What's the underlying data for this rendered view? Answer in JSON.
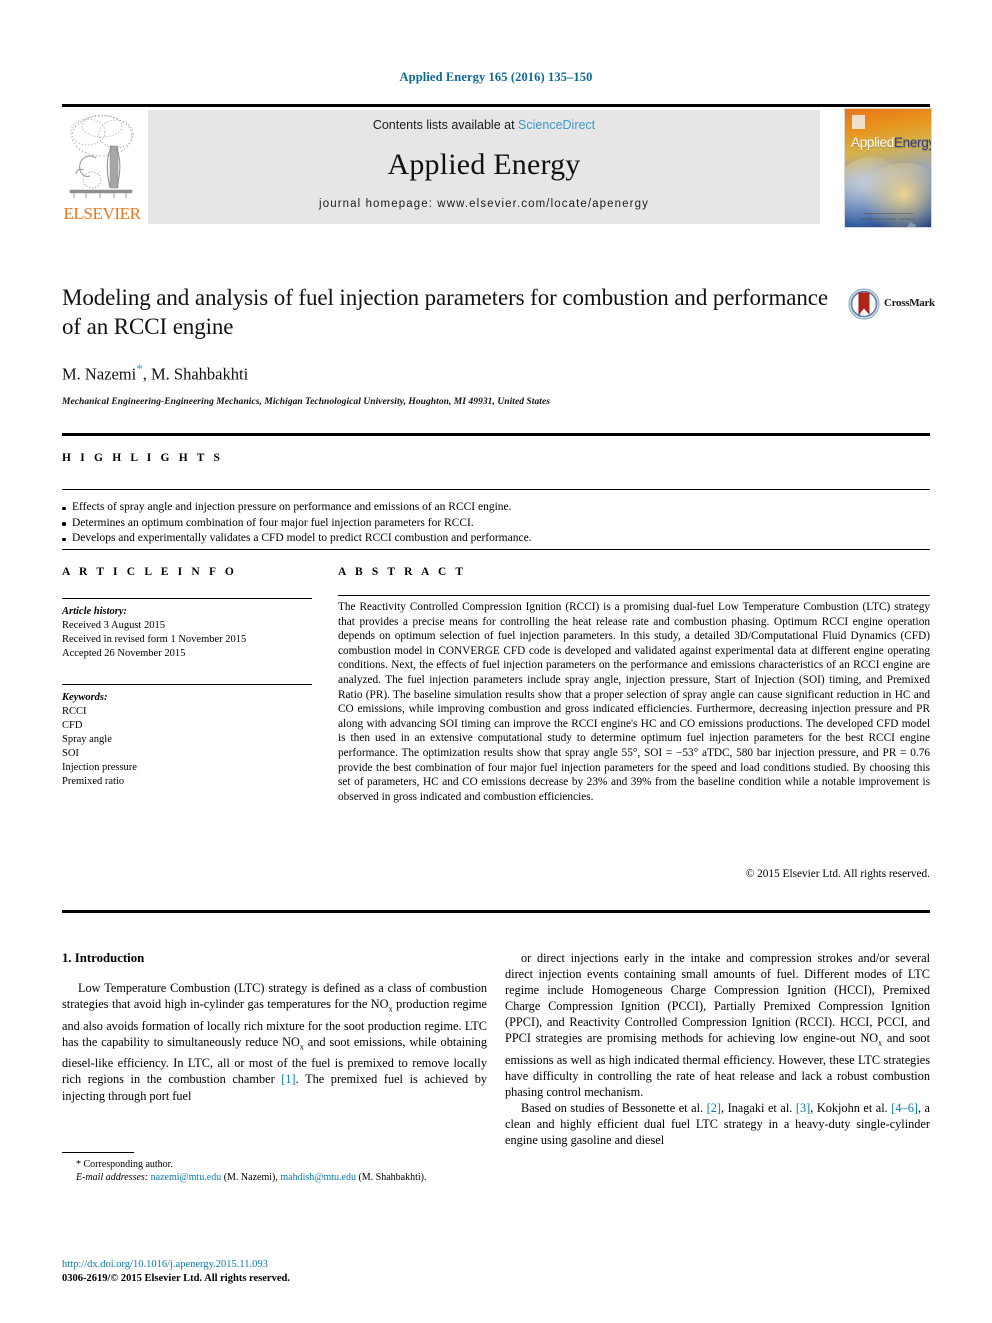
{
  "running_head": "Applied Energy 165 (2016) 135–150",
  "masthead": {
    "publisher_name": "ELSEVIER",
    "contents_prefix": "Contents lists available at",
    "contents_link": "ScienceDirect",
    "journal_title": "Applied Energy",
    "homepage": "journal homepage: www.elsevier.com/locate/apenergy",
    "cover_title_a": "Applied",
    "cover_title_b": "Energy",
    "cover_footer": "AN INTERNATIONAL JOURNAL"
  },
  "article": {
    "title": "Modeling and analysis of fuel injection parameters for combustion and performance of an RCCI engine",
    "authors": "M. Nazemi",
    "authors_rest": ", M. Shahbakhti",
    "corresponding_marker": "*",
    "affiliation": "Mechanical Engineering-Engineering Mechanics, Michigan Technological University, Houghton, MI 49931, United States",
    "crossmark_label": "CrossMark"
  },
  "highlights": {
    "label": "H I G H L I G H T S",
    "items": [
      "Effects of spray angle and injection pressure on performance and emissions of an RCCI engine.",
      "Determines an optimum combination of four major fuel injection parameters for RCCI.",
      "Develops and experimentally validates a CFD model to predict RCCI combustion and performance."
    ]
  },
  "article_info": {
    "label": "A R T I C L E    I N F O",
    "history_header": "Article history:",
    "history": [
      "Received 3 August 2015",
      "Received in revised form 1 November 2015",
      "Accepted 26 November 2015"
    ],
    "keywords_header": "Keywords:",
    "keywords": [
      "RCCI",
      "CFD",
      "Spray angle",
      "SOI",
      "Injection pressure",
      "Premixed ratio"
    ]
  },
  "abstract": {
    "label": "A B S T R A C T",
    "text": "The Reactivity Controlled Compression Ignition (RCCI) is a promising dual-fuel Low Temperature Combustion (LTC) strategy that provides a precise means for controlling the heat release rate and combustion phasing. Optimum RCCI engine operation depends on optimum selection of fuel injection parameters. In this study, a detailed 3D/Computational Fluid Dynamics (CFD) combustion model in CONVERGE CFD code is developed and validated against experimental data at different engine operating conditions. Next, the effects of fuel injection parameters on the performance and emissions characteristics of an RCCI engine are analyzed. The fuel injection parameters include spray angle, injection pressure, Start of Injection (SOI) timing, and Premixed Ratio (PR). The baseline simulation results show that a proper selection of spray angle can cause significant reduction in HC and CO emissions, while improving combustion and gross indicated efficiencies. Furthermore, decreasing injection pressure and PR along with advancing SOI timing can improve the RCCI engine's HC and CO emissions productions. The developed CFD model is then used in an extensive computational study to determine optimum fuel injection parameters for the best RCCI engine performance. The optimization results show that spray angle 55°, SOI = −53° aTDC, 580 bar injection pressure, and PR = 0.76 provide the best combination of four major fuel injection parameters for the speed and load conditions studied. By choosing this set of parameters, HC and CO emissions decrease by 23% and 39% from the baseline condition while a notable improvement is observed in gross indicated and combustion efficiencies.",
    "rights": "© 2015 Elsevier Ltd. All rights reserved."
  },
  "body": {
    "section_title": "1. Introduction",
    "left_p1_a": "Low Temperature Combustion (LTC) strategy is defined as a class of combustion strategies that avoid high in-cylinder gas temperatures for the NO",
    "left_p1_sub1": "x",
    "left_p1_b": " production regime and also avoids formation of locally rich mixture for the soot production regime. LTC has the capability to simultaneously reduce NO",
    "left_p1_sub2": "x",
    "left_p1_c": " and soot emissions, while obtaining diesel-like efficiency. In LTC, all or most of the fuel is premixed to remove locally rich regions in the combustion chamber ",
    "left_ref1": "[1]",
    "left_p1_d": ". The premixed fuel is achieved by injecting through port fuel",
    "right_p1_a": "or direct injections early in the intake and compression strokes and/or several direct injection events containing small amounts of fuel. Different modes of LTC regime include Homogeneous Charge Compression Ignition (HCCI), Premixed Charge Compression Ignition (PCCI), Partially Premixed Compression Ignition (PPCI), and Reactivity Controlled Compression Ignition (RCCI). HCCI, PCCI, and PPCI strategies are promising methods for achieving low engine-out NO",
    "right_p1_sub1": "x",
    "right_p1_b": " and soot emissions as well as high indicated thermal efficiency. However, these LTC strategies have difficulty in controlling the rate of heat release and lack a robust combustion phasing control mechanism.",
    "right_p2_a": "Based on studies of Bessonette et al. ",
    "right_ref2": "[2]",
    "right_p2_b": ", Inagaki et al. ",
    "right_ref3": "[3]",
    "right_p2_c": ", Kokjohn et al. ",
    "right_ref4": "[4–6]",
    "right_p2_d": ", a clean and highly efficient dual fuel LTC strategy in a heavy-duty single-cylinder engine using gasoline and diesel"
  },
  "footer": {
    "corresponding": "* Corresponding author.",
    "email_label": "E-mail addresses:",
    "email1": "nazemi@mtu.edu",
    "email1_name": "(M. Nazemi)",
    "email2": "mahdish@mtu.edu",
    "email2_name": "(M. Shahbakhti).",
    "doi": "http://dx.doi.org/10.1016/j.apenergy.2015.11.093",
    "issn": "0306-2619/© 2015 Elsevier Ltd. All rights reserved."
  },
  "colors": {
    "link_blue": "#0b6a96",
    "ref_blue": "#0b78b0",
    "sciencedirect_blue": "#3d9ad1",
    "elsevier_orange": "#e87722"
  }
}
